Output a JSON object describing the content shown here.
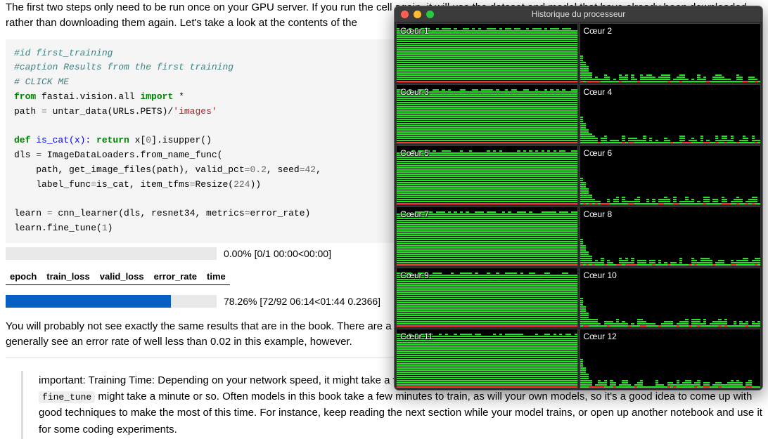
{
  "notebook": {
    "intro_text": "The first two steps only need to be run once on your GPU server. If you run the cell again, it will use the dataset and model that have already been downloaded, rather than downloading them again. Let's take a look at the contents of the",
    "code": {
      "c1": "#id first_training",
      "c2": "#caption Results from the first training",
      "c3": "# CLICK ME",
      "from": "from",
      "mod": " fastai.vision.all ",
      "import": "import",
      "star": " *",
      "l_path": "path ",
      "eq": "=",
      "untar": " untar_data(URLs.PETS)/",
      "images": "'images'",
      "def": "def",
      "is_cat_sig": " is_cat(x): ",
      "return": "return",
      "is_cat_body": " x[",
      "zero": "0",
      "isupper": "].isupper()",
      "dls": "dls ",
      "dls_body": " ImageDataLoaders.from_name_func(",
      "dls_l2a": "    path, get_image_files(path), valid_pct",
      "valpct": "0.2",
      "seedlbl": ", seed",
      "seed": "42",
      "comma": ",",
      "dls_l3a": "    label_func",
      "dls_l3b": "is_cat, item_tfms",
      "resize": "Resize(",
      "r224": "224",
      "close": "))",
      "learn": "learn ",
      "cnn": " cnn_learner(dls, resnet34, metrics",
      "err": "error_rate)",
      "ft": "learn.fine_tune(",
      "one": "1",
      "cp": ")"
    },
    "progress1": {
      "pct": 0,
      "text": "0.00% [0/1 00:00<00:00]"
    },
    "metrics_header": [
      "epoch",
      "train_loss",
      "valid_loss",
      "error_rate",
      "time"
    ],
    "progress2": {
      "pct": 78.26,
      "text": "78.26% [72/92 06:14<01:44 0.2366]"
    },
    "results_text": "You will probably not see exactly the same results that are in the book. There are a lot of sources of small random variation involved in training. You should generally see an error rate of well less than 0.02 in this example, however.",
    "blockquote_pre": "important: Training Time: Depending on your network speed, it might take a few minutes to download the pretrained model and dataset. Running ",
    "blockquote_code": "fine_tune",
    "blockquote_post": " might take a minute or so. Often models in this book take a few minutes to train, as will your own models, so it's a good idea to come up with good techniques to make the most of this time. For instance, keep reading the next section while your model trains, or open up another notebook and use it for some coding experiments."
  },
  "cpu": {
    "title": "Historique du processeur",
    "cores": [
      {
        "name": "Cœur 1",
        "pattern": "full"
      },
      {
        "name": "Cœur 2",
        "pattern": "low"
      },
      {
        "name": "Cœur 3",
        "pattern": "full"
      },
      {
        "name": "Cœur 4",
        "pattern": "low"
      },
      {
        "name": "Cœur 5",
        "pattern": "full"
      },
      {
        "name": "Cœur 6",
        "pattern": "low"
      },
      {
        "name": "Cœur 7",
        "pattern": "full"
      },
      {
        "name": "Cœur 8",
        "pattern": "low"
      },
      {
        "name": "Cœur 9",
        "pattern": "full"
      },
      {
        "name": "Cœur 10",
        "pattern": "low"
      },
      {
        "name": "Cœur 11",
        "pattern": "full"
      },
      {
        "name": "Cœur 12",
        "pattern": "low"
      }
    ]
  }
}
